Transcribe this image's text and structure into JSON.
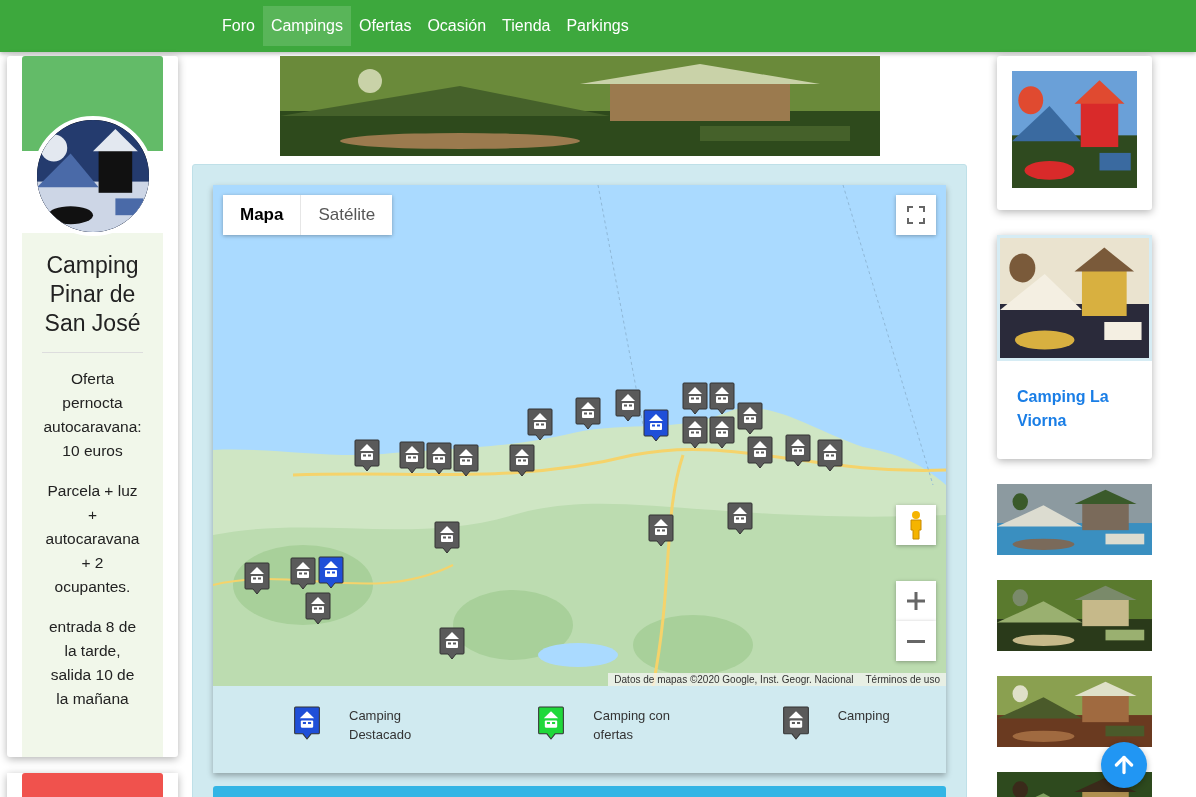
{
  "nav": [
    {
      "label": "Foro",
      "selected": false
    },
    {
      "label": "Campings",
      "selected": true
    },
    {
      "label": "Ofertas",
      "selected": false
    },
    {
      "label": "Ocasión",
      "selected": false
    },
    {
      "label": "Tienda",
      "selected": false
    },
    {
      "label": "Parkings",
      "selected": false
    }
  ],
  "profile": {
    "title": "Camping Pinar de San José",
    "notes": [
      "Oferta pernocta autocaravana: 10 euros",
      "Parcela + luz + autocaravana + 2 ocupantes.",
      "entrada 8 de la tarde, salida 10 de la mañana"
    ]
  },
  "map": {
    "types": [
      {
        "label": "Mapa",
        "selected": true
      },
      {
        "label": "Satélite",
        "selected": false
      }
    ],
    "attribution": "Datos de mapas ©2020 Google, Inst. Geogr. Nacional",
    "terms": "Términos de uso",
    "markers": [
      {
        "kind": "standard"
      },
      {
        "kind": "standard"
      },
      {
        "kind": "standard"
      },
      {
        "kind": "standard"
      },
      {
        "kind": "standard"
      },
      {
        "kind": "standard"
      },
      {
        "kind": "standard"
      },
      {
        "kind": "standard"
      },
      {
        "kind": "featured"
      },
      {
        "kind": "standard"
      },
      {
        "kind": "standard"
      },
      {
        "kind": "standard"
      },
      {
        "kind": "standard"
      },
      {
        "kind": "standard"
      },
      {
        "kind": "standard"
      },
      {
        "kind": "standard"
      },
      {
        "kind": "standard"
      },
      {
        "kind": "standard"
      },
      {
        "kind": "standard"
      },
      {
        "kind": "standard"
      },
      {
        "kind": "standard"
      },
      {
        "kind": "standard"
      },
      {
        "kind": "standard"
      },
      {
        "kind": "featured"
      },
      {
        "kind": "standard"
      }
    ]
  },
  "legend": [
    {
      "kind": "featured",
      "label": "Camping Destacado"
    },
    {
      "kind": "offer",
      "label": "Camping con ofertas"
    },
    {
      "kind": "standard",
      "label": "Camping"
    }
  ],
  "sidebar": {
    "featured_link": "Camping La Viorna"
  }
}
